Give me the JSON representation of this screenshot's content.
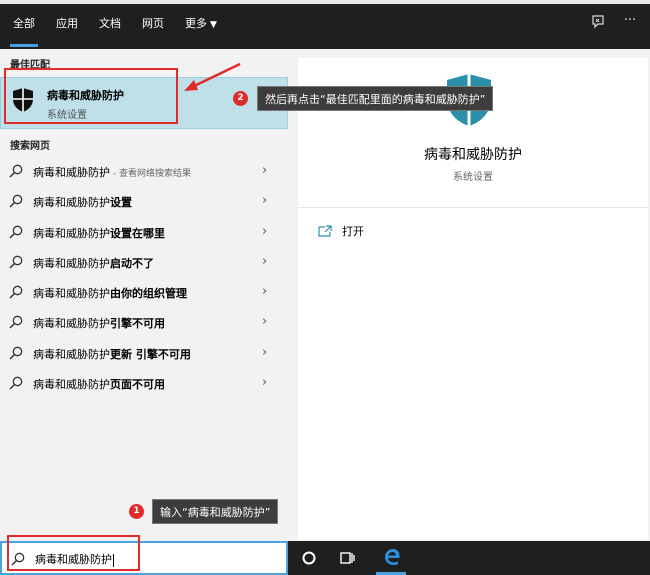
{
  "topbar": {
    "tabs": [
      {
        "label": "全部"
      },
      {
        "label": "应用"
      },
      {
        "label": "文档"
      },
      {
        "label": "网页"
      },
      {
        "label": "更多"
      }
    ],
    "feedback_icon": "feedback-icon",
    "more_icon": "ellipsis-icon",
    "more_glyph": "···"
  },
  "left": {
    "best_match_label": "最佳匹配",
    "best_match": {
      "title": "病毒和威胁防护",
      "subtitle": "系统设置"
    },
    "web_label": "搜索网页",
    "results": [
      {
        "prefix": "病毒和威胁防护",
        "bold": "",
        "suffix": " - 查看网络搜索结果"
      },
      {
        "prefix": "病毒和威胁防护",
        "bold": "设置",
        "suffix": ""
      },
      {
        "prefix": "病毒和威胁防护",
        "bold": "设置在哪里",
        "suffix": ""
      },
      {
        "prefix": "病毒和威胁防护",
        "bold": "启动不了",
        "suffix": ""
      },
      {
        "prefix": "病毒和威胁防护",
        "bold": "由你的组织管理",
        "suffix": ""
      },
      {
        "prefix": "病毒和威胁防护",
        "bold": "引擎不可用",
        "suffix": ""
      },
      {
        "prefix": "病毒和威胁防护",
        "bold": "更新 引擎不可用",
        "suffix": ""
      },
      {
        "prefix": "病毒和威胁防护",
        "bold": "页面不可用",
        "suffix": ""
      }
    ]
  },
  "right": {
    "title": "病毒和威胁防护",
    "subtitle": "系统设置",
    "open_label": "打开"
  },
  "annotations": {
    "step2": {
      "number": "2",
      "text": "然后再点击“最佳匹配里面的病毒和威胁防护”"
    },
    "step1": {
      "number": "1",
      "text": "输入“病毒和威胁防护”"
    },
    "color": "#e02b2b"
  },
  "search": {
    "value": "病毒和威胁防护"
  },
  "taskbar": {
    "icons": [
      "cortana-circle-icon",
      "task-view-icon",
      "edge-icon"
    ]
  },
  "colors": {
    "accent": "#4aa3df",
    "highlight": "#bfe0e8",
    "dark": "#1f1f1f"
  }
}
